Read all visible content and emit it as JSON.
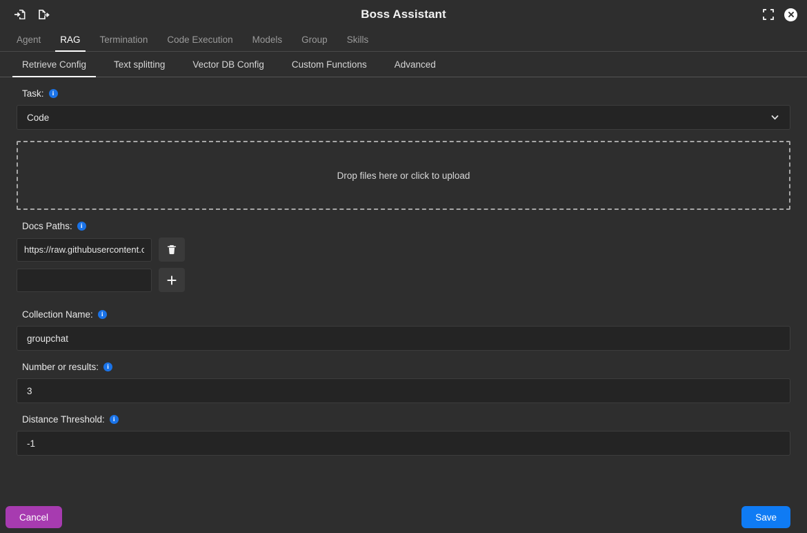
{
  "titlebar": {
    "title": "Boss Assistant",
    "import_icon": "import-file-icon",
    "export_icon": "export-file-icon",
    "fullscreen_icon": "fullscreen-icon",
    "close_icon": "close-icon"
  },
  "tabs": [
    {
      "label": "Agent",
      "active": false
    },
    {
      "label": "RAG",
      "active": true
    },
    {
      "label": "Termination",
      "active": false
    },
    {
      "label": "Code Execution",
      "active": false
    },
    {
      "label": "Models",
      "active": false
    },
    {
      "label": "Group",
      "active": false
    },
    {
      "label": "Skills",
      "active": false
    }
  ],
  "subtabs": [
    {
      "label": "Retrieve Config",
      "active": true
    },
    {
      "label": "Text splitting",
      "active": false
    },
    {
      "label": "Vector DB Config",
      "active": false
    },
    {
      "label": "Custom Functions",
      "active": false
    },
    {
      "label": "Advanced",
      "active": false
    }
  ],
  "form": {
    "task": {
      "label": "Task:",
      "info_icon": "info-icon",
      "value": "Code",
      "chevron_icon": "chevron-down-icon"
    },
    "upload": {
      "text": "Drop files here or click to upload"
    },
    "docs_paths": {
      "label": "Docs Paths:",
      "info_icon": "info-icon",
      "rows": [
        {
          "value": "https://raw.githubusercontent.c",
          "action_icon": "trash-icon",
          "action": "delete"
        },
        {
          "value": "",
          "placeholder": "",
          "action_icon": "plus-icon",
          "action": "add"
        }
      ]
    },
    "collection_name": {
      "label": "Collection Name:",
      "info_icon": "info-icon",
      "value": "groupchat"
    },
    "number_of_results": {
      "label": "Number or results:",
      "info_icon": "info-icon",
      "value": "3"
    },
    "distance_threshold": {
      "label": "Distance Threshold:",
      "info_icon": "info-icon",
      "value": "-1"
    }
  },
  "footer": {
    "cancel_label": "Cancel",
    "save_label": "Save"
  },
  "colors": {
    "background": "#2e2e2e",
    "input_background": "#242424",
    "accent_blue": "#0f7bf4",
    "info_blue": "#1a73e8",
    "cancel_purple": "#a73bb0"
  }
}
